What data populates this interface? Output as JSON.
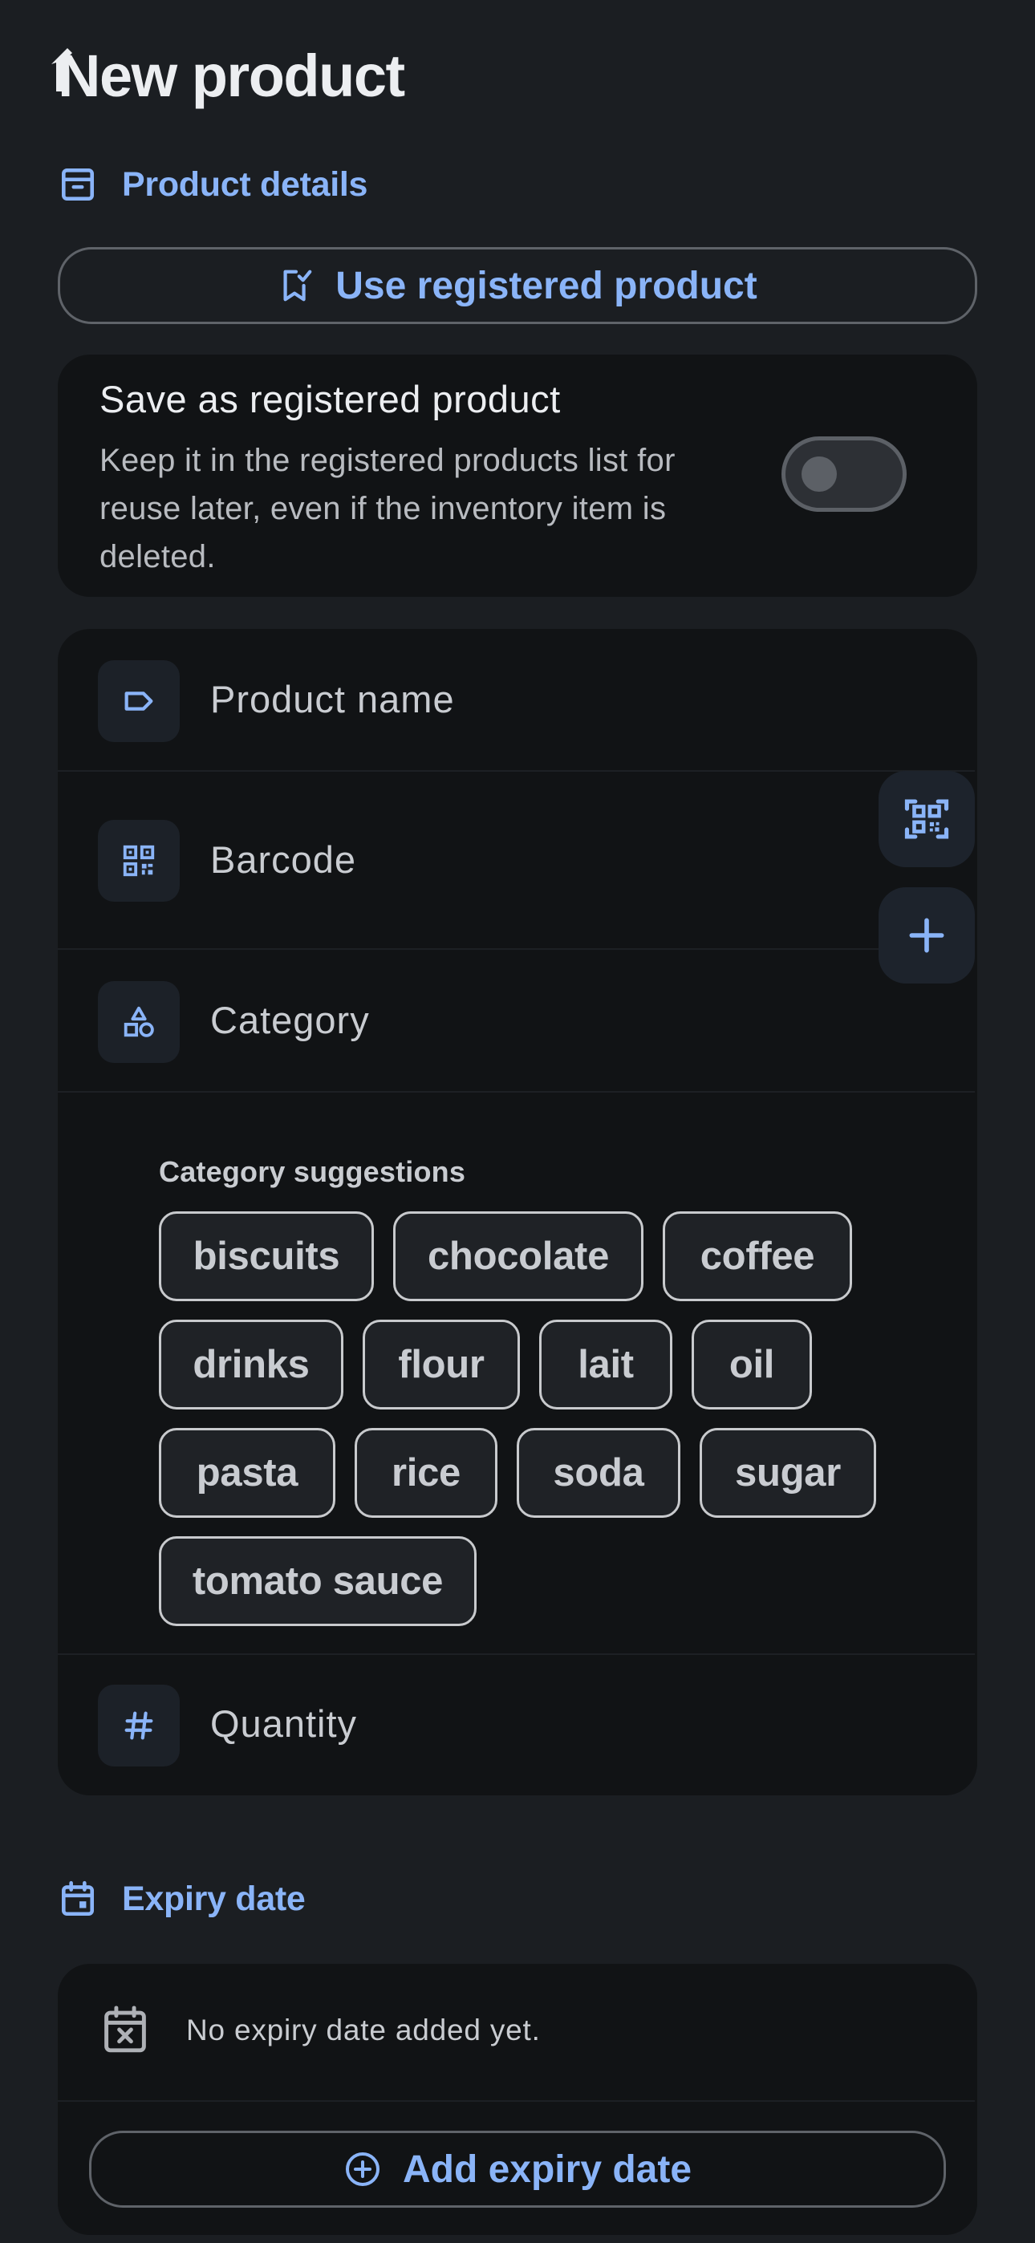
{
  "header": {
    "title": "New product"
  },
  "product_details": {
    "section_label": "Product details",
    "use_registered_label": "Use registered product",
    "save_registered": {
      "title": "Save as registered product",
      "description": "Keep it in the registered products list for reuse later, even if the inventory item is deleted.",
      "toggle_on": false
    },
    "fields": {
      "name_placeholder": "Product name",
      "barcode_placeholder": "Barcode",
      "category_placeholder": "Category",
      "quantity_placeholder": "Quantity"
    },
    "category_suggestions": {
      "title": "Category suggestions",
      "chips": [
        "biscuits",
        "chocolate",
        "coffee",
        "drinks",
        "flour",
        "lait",
        "oil",
        "pasta",
        "rice",
        "soda",
        "sugar",
        "tomato sauce"
      ]
    }
  },
  "expiry": {
    "section_label": "Expiry date",
    "empty_text": "No expiry date added yet.",
    "add_label": "Add expiry date"
  },
  "colors": {
    "background": "#1b1e22",
    "card": "#111315",
    "accent": "#8ab4f8",
    "text": "#e3e3e6",
    "muted": "#b8bbc0"
  },
  "icons": [
    "back-arrow-icon",
    "archive-box-icon",
    "bookmark-check-icon",
    "label-tag-icon",
    "qr-code-icon",
    "barcode-scan-icon",
    "plus-icon",
    "shapes-icon",
    "hash-icon",
    "calendar-icon",
    "calendar-x-icon",
    "add-circle-icon"
  ]
}
